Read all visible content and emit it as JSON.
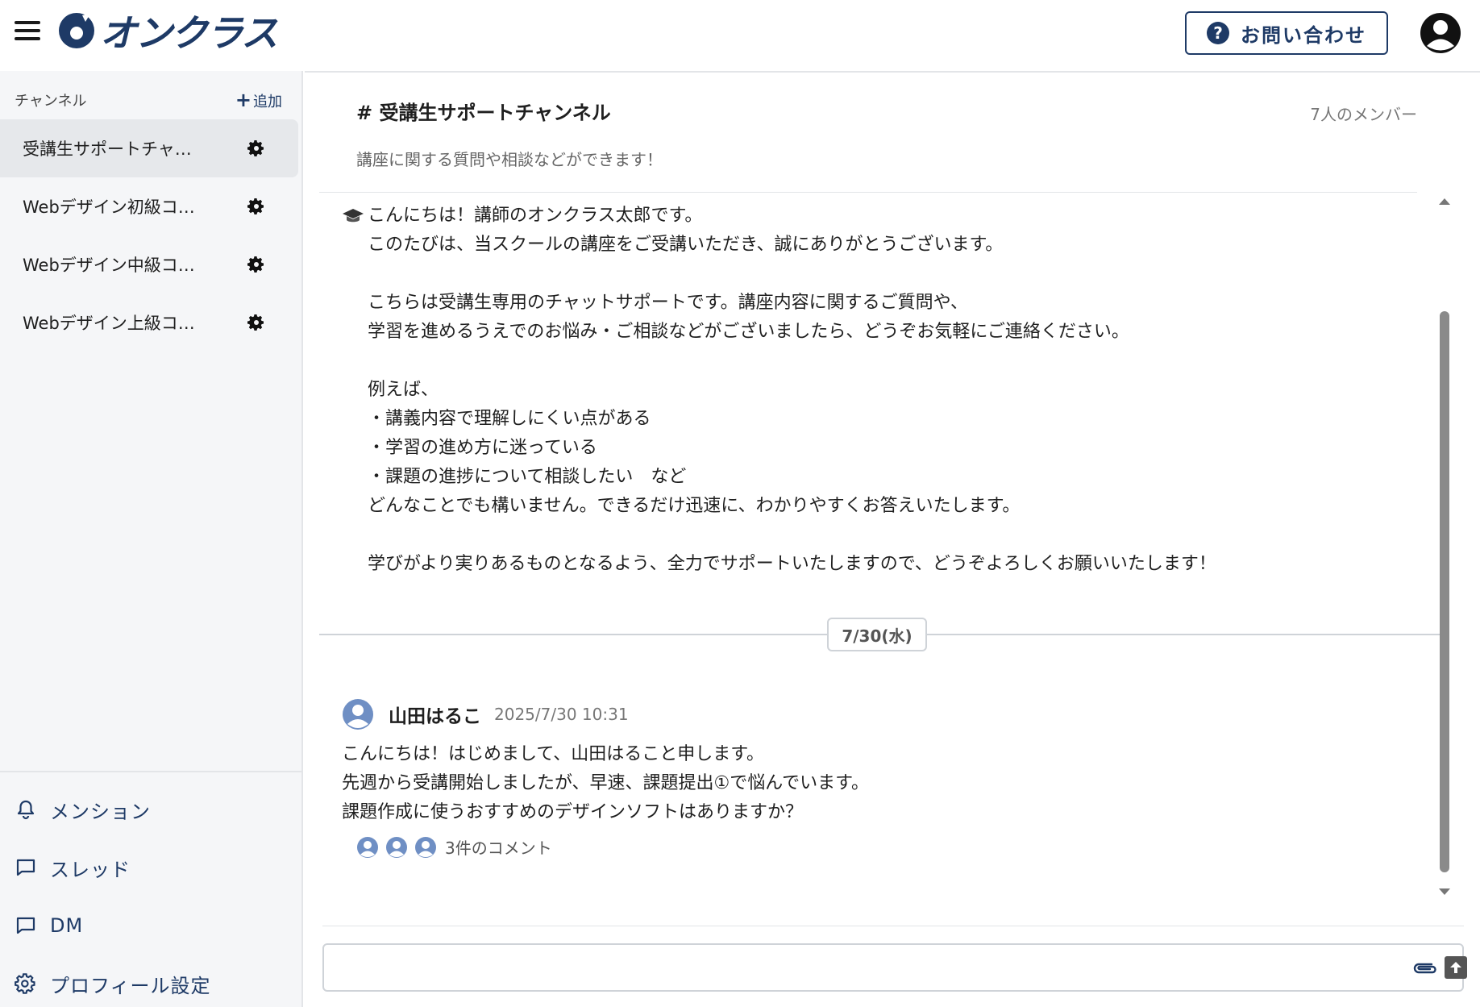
{
  "header": {
    "logo_text": "オンクラス",
    "contact_label": "お問い合わせ"
  },
  "sidebar": {
    "channel_section_title": "チャンネル",
    "add_label": "追加",
    "channels": [
      {
        "name": "受講生サポートチャ…",
        "active": true
      },
      {
        "name": "Webデザイン初級コ…",
        "active": false
      },
      {
        "name": "Webデザイン中級コ…",
        "active": false
      },
      {
        "name": "Webデザイン上級コ…",
        "active": false
      }
    ],
    "menu": [
      {
        "label": "メンション",
        "icon": "bell-icon"
      },
      {
        "label": "スレッド",
        "icon": "chat-bubble-icon"
      },
      {
        "label": "DM",
        "icon": "chat-bubble-icon"
      },
      {
        "label": "プロフィール設定",
        "icon": "gear-icon"
      }
    ]
  },
  "main": {
    "channel_title": "# 受講生サポートチャンネル",
    "member_count": "7人のメンバー",
    "channel_description": "講座に関する質問や相談などができます！",
    "pinned_message": "こんにちは！講師のオンクラス太郎です。\nこのたびは、当スクールの講座をご受講いただき、誠にありがとうございます。\n\nこちらは受講生専用のチャットサポートです。講座内容に関するご質問や、\n学習を進めるうえでのお悩み・ご相談などがございましたら、どうぞお気軽にご連絡ください。\n\n例えば、\n・講義内容で理解しにくい点がある\n・学習の進め方に迷っている\n・課題の進捗について相談したい　など\nどんなことでも構いません。できるだけ迅速に、わかりやすくお答えいたします。\n\n学びがより実りあるものとなるよう、全力でサポートいたしますので、どうぞよろしくお願いいたします！",
    "date_separator": "7/30(水)",
    "post": {
      "author": "山田はるこ",
      "timestamp": "2025/7/30 10:31",
      "body": "こんにちは！はじめまして、山田はること申します。\n先週から受講開始しましたが、早速、課題提出①で悩んでいます。\n課題作成に使うおすすめのデザインソフトはありますか？",
      "comment_count_label": "3件のコメント"
    },
    "compose": {
      "placeholder": "",
      "value": ""
    }
  },
  "colors": {
    "brand": "#1e3a66",
    "avatar": "#6f8fc4",
    "sidebar_bg": "#f5f6f8"
  }
}
